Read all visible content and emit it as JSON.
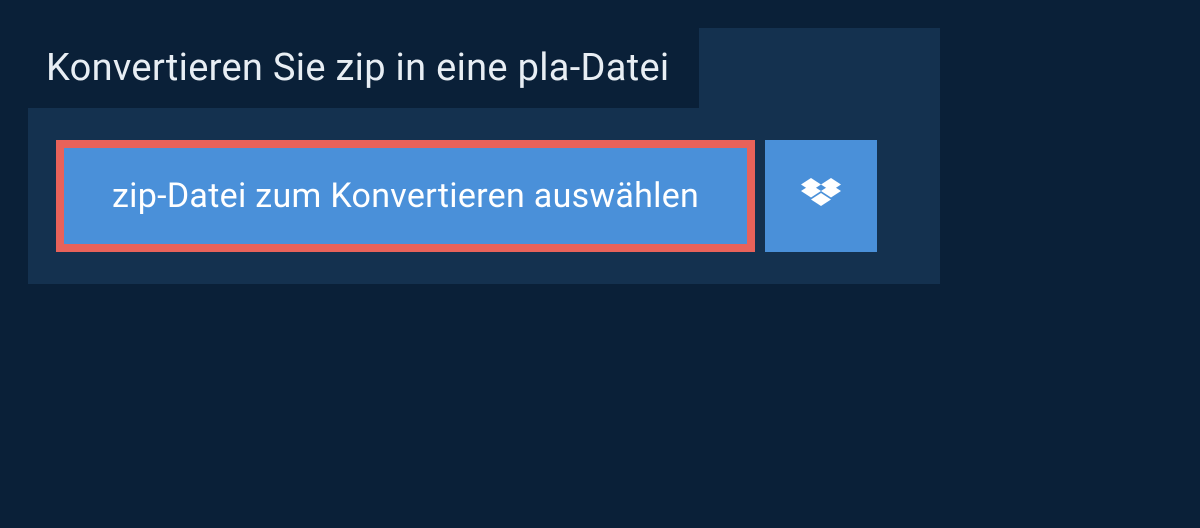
{
  "heading": "Konvertieren Sie zip in eine pla-Datei",
  "select_button_label": "zip-Datei zum Konvertieren auswählen",
  "colors": {
    "page_bg": "#0a2038",
    "panel_bg": "#14314f",
    "button_bg": "#4a90d9",
    "highlight_border": "#e8625a",
    "text": "#ffffff"
  },
  "icons": {
    "dropbox": "dropbox-icon"
  }
}
